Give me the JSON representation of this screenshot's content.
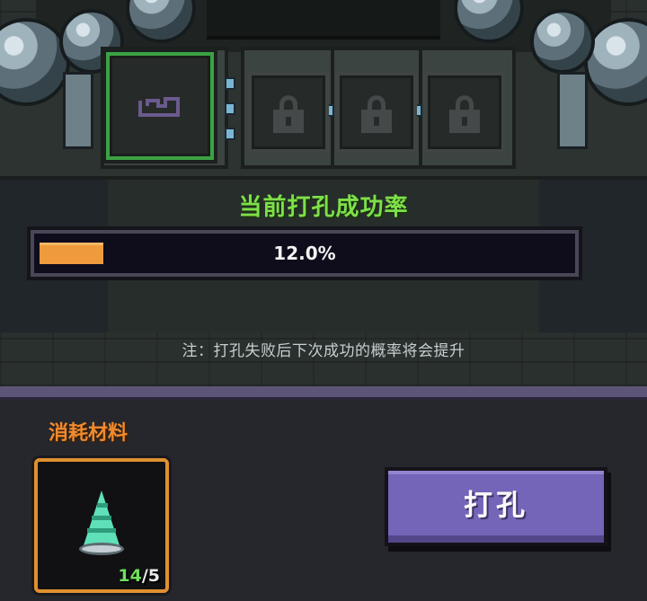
{
  "socket_panel": {
    "slots": [
      {
        "state": "active",
        "icon": "socket-item-outline-icon"
      },
      {
        "state": "locked",
        "icon": "lock-icon"
      },
      {
        "state": "locked",
        "icon": "lock-icon"
      },
      {
        "state": "locked",
        "icon": "lock-icon"
      }
    ]
  },
  "success_rate": {
    "title": "当前打孔成功率",
    "value": 0.12,
    "label": "12.0%"
  },
  "note": "注：打孔失败后下次成功的概率将会提升",
  "materials": {
    "title": "消耗材料",
    "item_icon": "drill-bit-icon",
    "have": "14",
    "need": "/5"
  },
  "action": {
    "button_label": "打孔"
  },
  "colors": {
    "active_slot_border": "#3ba243",
    "rate_title": "#7ee048",
    "progress_fill": "#ef9a3c",
    "material_border": "#e0902f",
    "button_bg": "#7565b8",
    "count_have": "#6fe05b"
  }
}
